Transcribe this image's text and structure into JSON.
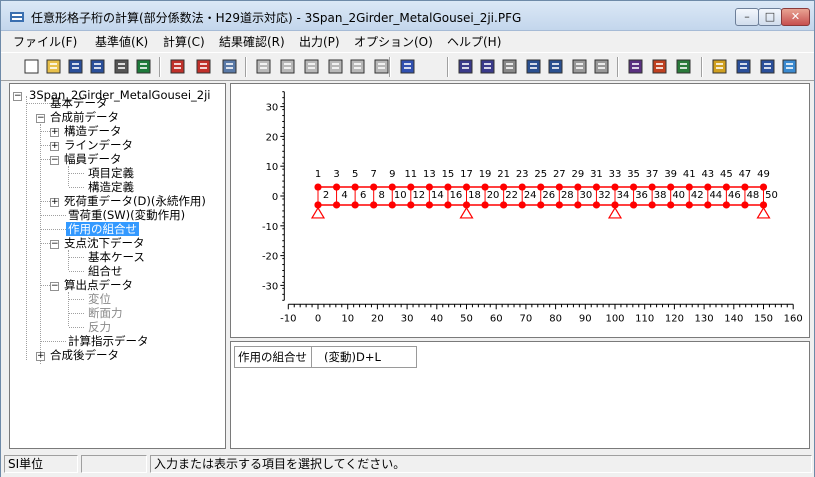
{
  "window": {
    "title": "任意形格子桁の計算(部分係数法・H29道示対応) - 3Span_2Girder_MetalGousei_2ji.PFG",
    "minimize": "–",
    "maximize": "□",
    "close": "✕"
  },
  "menu": [
    {
      "label": "ファイル(F)"
    },
    {
      "label": "基準値(K)"
    },
    {
      "label": "計算(C)"
    },
    {
      "label": "結果確認(R)"
    },
    {
      "label": "出力(P)"
    },
    {
      "label": "オプション(O)"
    },
    {
      "label": "ヘルプ(H)"
    }
  ],
  "toolbar": {
    "icons": [
      "new-file-icon",
      "open-folder-icon",
      "save-icon",
      "save-as-icon",
      "delete-icon",
      "export-icon",
      "node-edit-icon",
      "member-edit-icon",
      "table-icon",
      "grid-a-icon",
      "grid-b-icon",
      "grid-c-icon",
      "grid-d-icon",
      "grid-e-icon",
      "grid-f-icon",
      "3d-view-icon",
      "print-icon",
      "print-preview-icon",
      "print-setup-icon",
      "table-output-icon",
      "chart-output-icon",
      "chart-b-icon",
      "chart-c-icon",
      "edit-sheet-icon",
      "calc-sheet-icon",
      "check-sheet-icon",
      "help-icon",
      "book-icon",
      "id-card-icon",
      "layout-icon"
    ]
  },
  "tree": {
    "items": [
      {
        "label": "3Span_2Girder_MetalGousei_2ji"
      },
      {
        "label": "基本データ"
      },
      {
        "label": "合成前データ"
      },
      {
        "label": "構造データ"
      },
      {
        "label": "ラインデータ"
      },
      {
        "label": "幅員データ"
      },
      {
        "label": "項目定義"
      },
      {
        "label": "構造定義"
      },
      {
        "label": "死荷重データ(D)(永続作用)"
      },
      {
        "label": "雪荷重(SW)(変動作用)"
      },
      {
        "label": "作用の組合せ"
      },
      {
        "label": "支点沈下データ"
      },
      {
        "label": "基本ケース"
      },
      {
        "label": "組合せ"
      },
      {
        "label": "算出点データ"
      },
      {
        "label": "変位"
      },
      {
        "label": "断面力"
      },
      {
        "label": "反力"
      },
      {
        "label": "計算指示データ"
      },
      {
        "label": "合成後データ"
      }
    ]
  },
  "chart_data": {
    "type": "structure-diagram",
    "xlim": [
      -10,
      160
    ],
    "ylim": [
      -35,
      35
    ],
    "x_ticks": [
      -10,
      0,
      10,
      20,
      30,
      40,
      50,
      60,
      70,
      80,
      90,
      100,
      110,
      120,
      130,
      140,
      150,
      160
    ],
    "y_ticks": [
      30,
      20,
      10,
      0,
      -10,
      -20,
      -30
    ],
    "top_girder_y": 3,
    "bottom_girder_y": -3,
    "girder_x_range": [
      0,
      150
    ],
    "node_x": [
      0,
      6.25,
      12.5,
      18.75,
      25,
      31.25,
      37.5,
      43.75,
      50,
      56.25,
      62.5,
      68.75,
      75,
      81.25,
      87.5,
      93.75,
      100,
      106.25,
      112.5,
      118.75,
      125,
      131.25,
      137.5,
      143.75,
      150
    ],
    "top_labels": [
      "1",
      "3",
      "5",
      "7",
      "9",
      "11",
      "13",
      "15",
      "17",
      "19",
      "21",
      "23",
      "25",
      "27",
      "29",
      "31",
      "33",
      "35",
      "37",
      "39",
      "41",
      "43",
      "45",
      "47",
      "49"
    ],
    "bottom_labels": [
      "2",
      "4",
      "6",
      "8",
      "10",
      "12",
      "14",
      "16",
      "18",
      "20",
      "22",
      "24",
      "26",
      "28",
      "30",
      "32",
      "34",
      "36",
      "38",
      "40",
      "42",
      "44",
      "46",
      "48",
      "50"
    ],
    "supports_x": [
      0,
      50,
      100,
      150
    ],
    "colors": {
      "node": "#ff0000",
      "member": "#ff0000",
      "support": "#ff0000",
      "axis": "#000000"
    }
  },
  "grid": {
    "header": "作用の組合せ",
    "value": "(変動)D+L"
  },
  "status": {
    "unit": "SI単位",
    "empty": "",
    "message": "入力または表示する項目を選択してください。"
  }
}
